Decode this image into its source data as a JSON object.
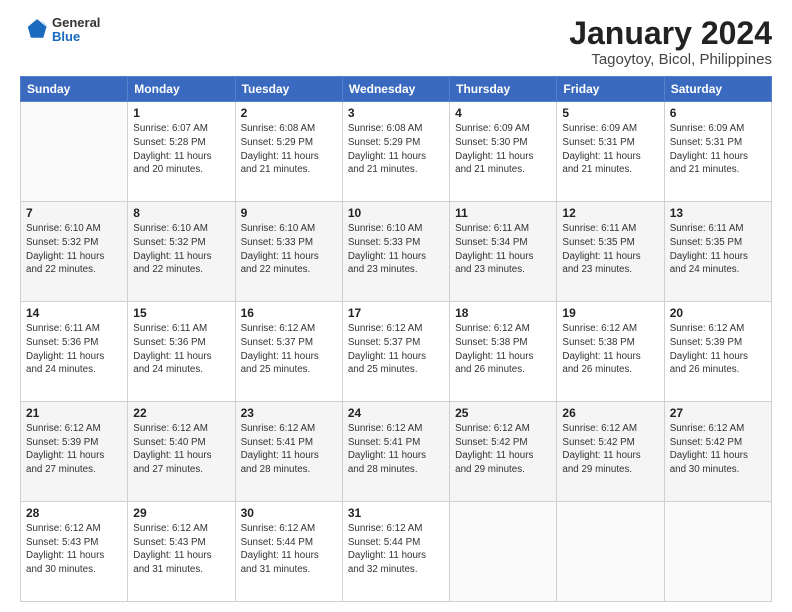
{
  "header": {
    "logo": {
      "general": "General",
      "blue": "Blue"
    },
    "title": "January 2024",
    "subtitle": "Tagoytoy, Bicol, Philippines"
  },
  "weekdays": [
    "Sunday",
    "Monday",
    "Tuesday",
    "Wednesday",
    "Thursday",
    "Friday",
    "Saturday"
  ],
  "weeks": [
    [
      {
        "day": "",
        "info": ""
      },
      {
        "day": "1",
        "info": "Sunrise: 6:07 AM\nSunset: 5:28 PM\nDaylight: 11 hours\nand 20 minutes."
      },
      {
        "day": "2",
        "info": "Sunrise: 6:08 AM\nSunset: 5:29 PM\nDaylight: 11 hours\nand 21 minutes."
      },
      {
        "day": "3",
        "info": "Sunrise: 6:08 AM\nSunset: 5:29 PM\nDaylight: 11 hours\nand 21 minutes."
      },
      {
        "day": "4",
        "info": "Sunrise: 6:09 AM\nSunset: 5:30 PM\nDaylight: 11 hours\nand 21 minutes."
      },
      {
        "day": "5",
        "info": "Sunrise: 6:09 AM\nSunset: 5:31 PM\nDaylight: 11 hours\nand 21 minutes."
      },
      {
        "day": "6",
        "info": "Sunrise: 6:09 AM\nSunset: 5:31 PM\nDaylight: 11 hours\nand 21 minutes."
      }
    ],
    [
      {
        "day": "7",
        "info": "Sunrise: 6:10 AM\nSunset: 5:32 PM\nDaylight: 11 hours\nand 22 minutes."
      },
      {
        "day": "8",
        "info": "Sunrise: 6:10 AM\nSunset: 5:32 PM\nDaylight: 11 hours\nand 22 minutes."
      },
      {
        "day": "9",
        "info": "Sunrise: 6:10 AM\nSunset: 5:33 PM\nDaylight: 11 hours\nand 22 minutes."
      },
      {
        "day": "10",
        "info": "Sunrise: 6:10 AM\nSunset: 5:33 PM\nDaylight: 11 hours\nand 23 minutes."
      },
      {
        "day": "11",
        "info": "Sunrise: 6:11 AM\nSunset: 5:34 PM\nDaylight: 11 hours\nand 23 minutes."
      },
      {
        "day": "12",
        "info": "Sunrise: 6:11 AM\nSunset: 5:35 PM\nDaylight: 11 hours\nand 23 minutes."
      },
      {
        "day": "13",
        "info": "Sunrise: 6:11 AM\nSunset: 5:35 PM\nDaylight: 11 hours\nand 24 minutes."
      }
    ],
    [
      {
        "day": "14",
        "info": "Sunrise: 6:11 AM\nSunset: 5:36 PM\nDaylight: 11 hours\nand 24 minutes."
      },
      {
        "day": "15",
        "info": "Sunrise: 6:11 AM\nSunset: 5:36 PM\nDaylight: 11 hours\nand 24 minutes."
      },
      {
        "day": "16",
        "info": "Sunrise: 6:12 AM\nSunset: 5:37 PM\nDaylight: 11 hours\nand 25 minutes."
      },
      {
        "day": "17",
        "info": "Sunrise: 6:12 AM\nSunset: 5:37 PM\nDaylight: 11 hours\nand 25 minutes."
      },
      {
        "day": "18",
        "info": "Sunrise: 6:12 AM\nSunset: 5:38 PM\nDaylight: 11 hours\nand 26 minutes."
      },
      {
        "day": "19",
        "info": "Sunrise: 6:12 AM\nSunset: 5:38 PM\nDaylight: 11 hours\nand 26 minutes."
      },
      {
        "day": "20",
        "info": "Sunrise: 6:12 AM\nSunset: 5:39 PM\nDaylight: 11 hours\nand 26 minutes."
      }
    ],
    [
      {
        "day": "21",
        "info": "Sunrise: 6:12 AM\nSunset: 5:39 PM\nDaylight: 11 hours\nand 27 minutes."
      },
      {
        "day": "22",
        "info": "Sunrise: 6:12 AM\nSunset: 5:40 PM\nDaylight: 11 hours\nand 27 minutes."
      },
      {
        "day": "23",
        "info": "Sunrise: 6:12 AM\nSunset: 5:41 PM\nDaylight: 11 hours\nand 28 minutes."
      },
      {
        "day": "24",
        "info": "Sunrise: 6:12 AM\nSunset: 5:41 PM\nDaylight: 11 hours\nand 28 minutes."
      },
      {
        "day": "25",
        "info": "Sunrise: 6:12 AM\nSunset: 5:42 PM\nDaylight: 11 hours\nand 29 minutes."
      },
      {
        "day": "26",
        "info": "Sunrise: 6:12 AM\nSunset: 5:42 PM\nDaylight: 11 hours\nand 29 minutes."
      },
      {
        "day": "27",
        "info": "Sunrise: 6:12 AM\nSunset: 5:42 PM\nDaylight: 11 hours\nand 30 minutes."
      }
    ],
    [
      {
        "day": "28",
        "info": "Sunrise: 6:12 AM\nSunset: 5:43 PM\nDaylight: 11 hours\nand 30 minutes."
      },
      {
        "day": "29",
        "info": "Sunrise: 6:12 AM\nSunset: 5:43 PM\nDaylight: 11 hours\nand 31 minutes."
      },
      {
        "day": "30",
        "info": "Sunrise: 6:12 AM\nSunset: 5:44 PM\nDaylight: 11 hours\nand 31 minutes."
      },
      {
        "day": "31",
        "info": "Sunrise: 6:12 AM\nSunset: 5:44 PM\nDaylight: 11 hours\nand 32 minutes."
      },
      {
        "day": "",
        "info": ""
      },
      {
        "day": "",
        "info": ""
      },
      {
        "day": "",
        "info": ""
      }
    ]
  ]
}
